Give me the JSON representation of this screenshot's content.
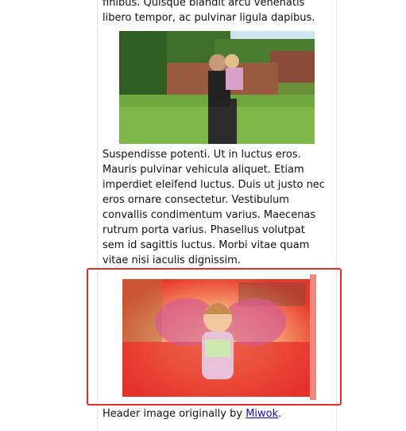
{
  "article": {
    "para_top": "finibus. Quisque blandit arcu venenatis libero tempor, ac pulvinar ligula dapibus.",
    "para_mid": "Suspendisse potenti. Ut in luctus eros. Mauris pulvinar vehicula aliquet. Etiam imperdiet eleifend luctus. Duis ut justo nec eros ornare consectetur. Vestibulum convallis condimentum varius. Maecenas rutrum porta varius. Phasellus volutpat sem id sagittis luctus. Morbi vitae quam vitae nisi iaculis dignissim.",
    "caption_prefix": "Header image originally by ",
    "caption_link": "Miwok",
    "caption_suffix": "."
  },
  "colors": {
    "highlight_border": "#e0302a",
    "link": "#1a0dab"
  },
  "images": {
    "photo1": "man-holding-child-in-garden-photo",
    "photo2": "child-in-fairy-costume-photo"
  }
}
